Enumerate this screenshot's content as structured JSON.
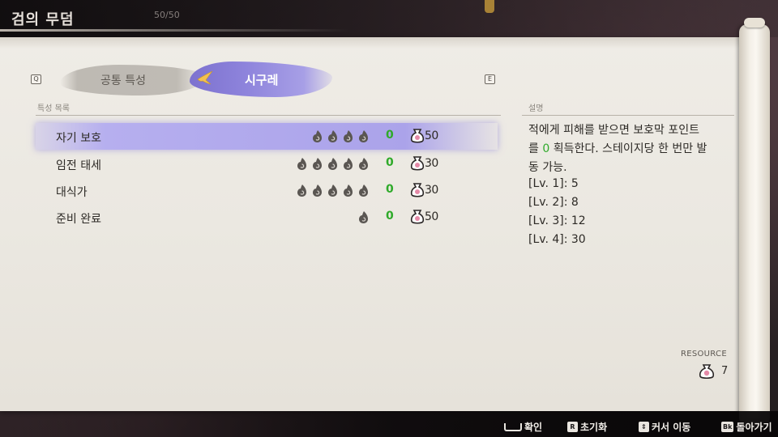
{
  "header": {
    "title": "검의 무덤",
    "count": "50/50"
  },
  "tabs": {
    "prev_key": "Q",
    "next_key": "E",
    "items": [
      {
        "label": "공통 특성",
        "active": false
      },
      {
        "label": "시구레",
        "active": true
      }
    ]
  },
  "list": {
    "header": "특성 목록",
    "rows": [
      {
        "name": "자기 보호",
        "cost_icons": 4,
        "level": "0",
        "price": "50",
        "selected": true
      },
      {
        "name": "임전 태세",
        "cost_icons": 5,
        "level": "0",
        "price": "30",
        "selected": false
      },
      {
        "name": "대식가",
        "cost_icons": 5,
        "level": "0",
        "price": "30",
        "selected": false
      },
      {
        "name": "준비 완료",
        "cost_icons": 1,
        "level": "0",
        "price": "50",
        "selected": false
      }
    ]
  },
  "description": {
    "header": "설명",
    "line1": "적에게 피해를 받으면 보호막 포인트",
    "line2_pre": "를 ",
    "line2_num": "0",
    "line2_post": " 획득한다. 스테이지당 한 번만 발",
    "line3": "동 가능.",
    "levels": [
      "[Lv. 1]: 5",
      "[Lv. 2]: 8",
      "[Lv. 3]: 12",
      "[Lv. 4]: 30"
    ]
  },
  "resource": {
    "label": "RESOURCE",
    "value": "7"
  },
  "hints": [
    {
      "key": "",
      "label": "확인"
    },
    {
      "key": "R",
      "label": "초기화"
    },
    {
      "key": "",
      "label": "커서 이동"
    },
    {
      "key": "Bk",
      "label": "돌아가기"
    }
  ],
  "colors": {
    "accent": "#9c94e4",
    "level": "#2faa2a",
    "paper": "#ece9e3"
  }
}
